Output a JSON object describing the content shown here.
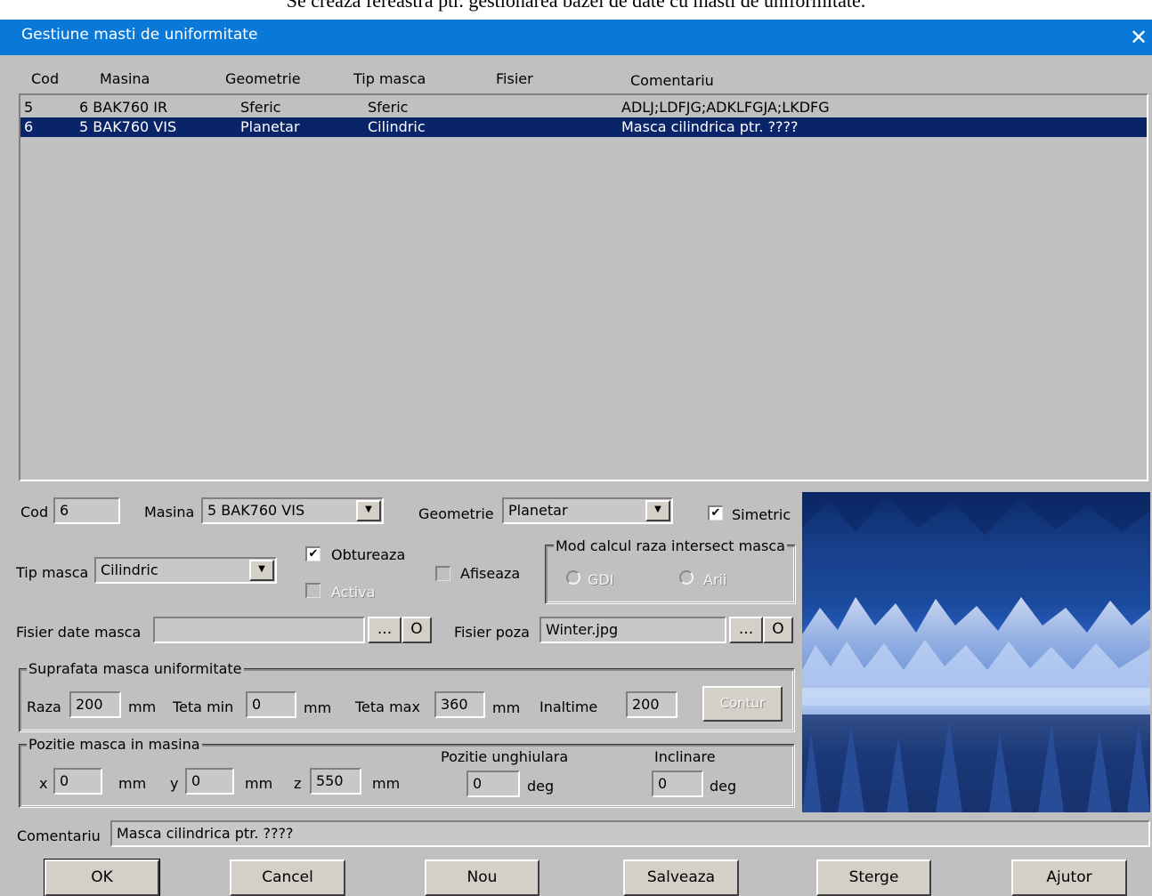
{
  "caption": "Se creaza fereastra ptr. gestionarea bazei de date cu masti de uniformitate.",
  "window": {
    "title": "Gestiune masti de uniformitate",
    "close_glyph": "✕"
  },
  "list": {
    "headers": [
      "Cod",
      "Masina",
      "Geometrie",
      "Tip masca",
      "Fisier",
      "Comentariu"
    ],
    "rows": [
      {
        "cod": "5",
        "masina": "6 BAK760 IR",
        "geometrie": "Sferic",
        "tip": "Sferic",
        "fisier": "",
        "comentariu": "ADLJ;LDFJG;ADKLFGJA;LKDFG",
        "selected": false
      },
      {
        "cod": "6",
        "masina": "5 BAK760 VIS",
        "geometrie": "Planetar",
        "tip": "Cilindric",
        "fisier": "",
        "comentariu": "Masca cilindrica ptr. ????",
        "selected": true
      }
    ]
  },
  "form": {
    "cod_label": "Cod",
    "cod_value": "6",
    "masina_label": "Masina",
    "masina_value": "5 BAK760 VIS",
    "geometrie_label": "Geometrie",
    "geometrie_value": "Planetar",
    "simetric_label": "Simetric",
    "simetric_checked": true,
    "tip_label": "Tip masca",
    "tip_value": "Cilindric",
    "obtureaza_label": "Obtureaza",
    "obtureaza_checked": true,
    "activa_label": "Activa",
    "activa_checked": false,
    "afiseaza_label": "Afiseaza",
    "afiseaza_checked": false,
    "mod_group_title": "Mod calcul raza intersect masca",
    "mod_gdi": "GDI",
    "mod_arii": "Arii",
    "fisier_date_label": "Fisier date masca",
    "fisier_date_value": "",
    "browse_label": "...",
    "open_label": "O",
    "fisier_poza_label": "Fisier poza",
    "fisier_poza_value": "Winter.jpg",
    "supr_group_title": "Suprafata masca uniformitate",
    "raza_label": "Raza",
    "raza_value": "200",
    "mm": "mm",
    "teta_min_label": "Teta min",
    "teta_min_value": "0",
    "teta_max_label": "Teta max",
    "teta_max_value": "360",
    "inaltime_label": "Inaltime",
    "inaltime_value": "200",
    "contur_label": "Contur",
    "poz_group_title": "Pozitie masca in masina",
    "x_label": "x",
    "x_value": "0",
    "y_label": "y",
    "y_value": "0",
    "z_label": "z",
    "z_value": "550",
    "poz_ung_label": "Pozitie unghiulara",
    "poz_ung_value": "0",
    "deg": "deg",
    "inclinare_label": "Inclinare",
    "inclinare_value": "0",
    "comentariu_label": "Comentariu",
    "comentariu_value": "Masca cilindrica ptr. ????"
  },
  "buttons": {
    "ok": "OK",
    "cancel": "Cancel",
    "nou": "Nou",
    "salveaza": "Salveaza",
    "sterge": "Sterge",
    "ajutor": "Ajutor"
  },
  "icons": {
    "check": "✔",
    "dropdown": "▼"
  },
  "colors": {
    "titlebar": "#0a78d7",
    "selection": "#0a246a",
    "dialog": "#c0c0c0"
  }
}
